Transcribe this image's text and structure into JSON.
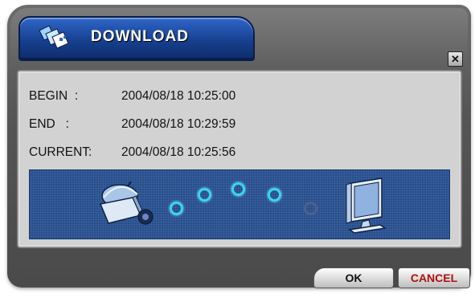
{
  "dialog": {
    "title": "DOWNLOAD",
    "close_glyph": "✕"
  },
  "times": {
    "begin_label": "BEGIN  :",
    "begin_value": "2004/08/18 10:25:00",
    "end_label": "END   :",
    "end_value": "2004/08/18 10:29:59",
    "current_label": "CURRENT:",
    "current_value": "2004/08/18 10:25:56"
  },
  "progress": {
    "source_icon": "camera-icon",
    "target_icon": "monitor-icon",
    "indicator_states": [
      "on",
      "on",
      "on",
      "on",
      "off"
    ]
  },
  "buttons": {
    "ok_label": "OK",
    "cancel_label": "CANCEL"
  },
  "colors": {
    "title_bar": "#17408f",
    "panel": "#d2d2d2",
    "progress_bg": "#274e8d",
    "indicator_active": "#39d7ef",
    "indicator_inactive": "#4f5f8e",
    "cancel_text": "#b01010"
  }
}
